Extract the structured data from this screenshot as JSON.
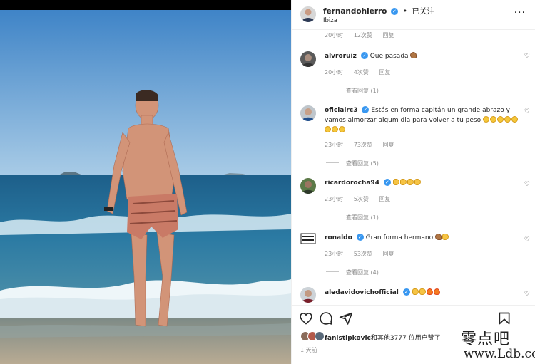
{
  "post": {
    "username": "fernandohierro",
    "follow_dot": "•",
    "follow_label": "已关注",
    "location": "Ibiza",
    "more_icon": "more-horizontal-icon"
  },
  "comments": [
    {
      "meta_time": "20小时",
      "meta_likes": "12次赞",
      "meta_reply": "回复"
    },
    {
      "user": "alvroruiz",
      "text": "Que pasada",
      "time": "20小时",
      "likes": "4次赞",
      "reply": "回复",
      "replies": "查看回复 (1)"
    },
    {
      "user": "oficialrc3",
      "text": "Estás en forma capitán un grande abrazo y vamos almorzar algum dia para volver a tu peso",
      "time": "23小时",
      "likes": "73次赞",
      "reply": "回复",
      "replies": "查看回复 (5)"
    },
    {
      "user": "ricardorocha94",
      "text": "",
      "time": "23小时",
      "likes": "5次赞",
      "reply": "回复",
      "replies": "查看回复 (1)"
    },
    {
      "user": "ronaldo",
      "text": "Gran forma hermano",
      "time": "23小时",
      "likes": "53次赞",
      "reply": "回复",
      "replies": "查看回复 (4)"
    },
    {
      "user": "aledavidovichofficial",
      "text": ""
    }
  ],
  "likes": {
    "user": "fanistipkovic",
    "text": "和其他3777 位用户赞了"
  },
  "time_ago": "1 天前",
  "watermark": {
    "line1": "零点吧",
    "line2": "www.Ldb.cc"
  },
  "colors": {
    "verified": "#3897f0",
    "muted": "#8e8e8e",
    "text": "#262626"
  }
}
